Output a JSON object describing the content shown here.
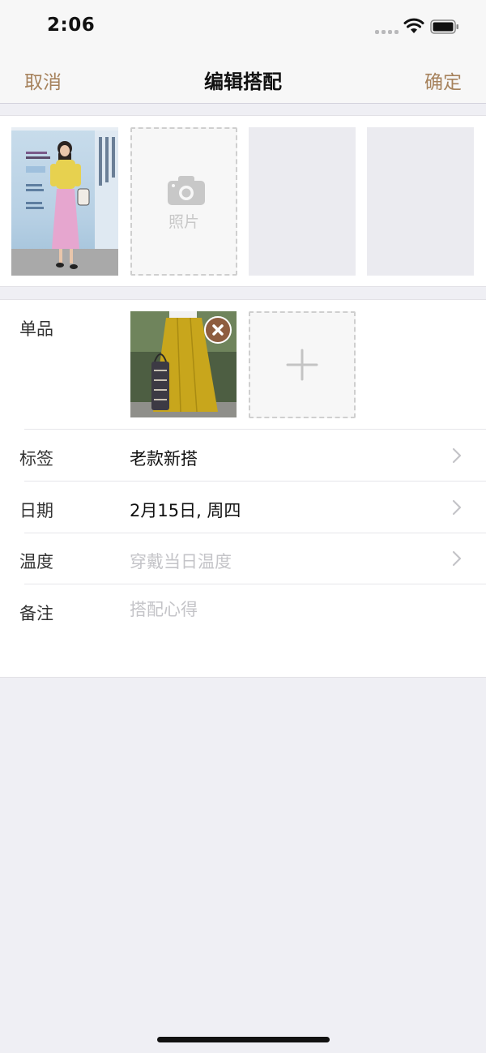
{
  "status_bar": {
    "time": "2:06"
  },
  "nav": {
    "cancel": "取消",
    "title": "编辑搭配",
    "confirm": "确定"
  },
  "photos": {
    "add_label": "照片"
  },
  "form": {
    "items_label": "单品",
    "tag_label": "标签",
    "tag_value": "老款新搭",
    "date_label": "日期",
    "date_value": "2月15日, 周四",
    "temperature_label": "温度",
    "temperature_placeholder": "穿戴当日温度",
    "note_label": "备注",
    "note_placeholder": "搭配心得"
  },
  "colors": {
    "accent": "#a6825c",
    "background": "#efeff4",
    "remove_badge": "#8e5d3f"
  }
}
